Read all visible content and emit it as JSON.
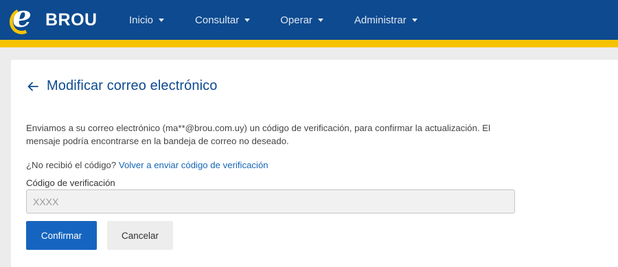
{
  "brand": {
    "name": "BROU",
    "logo_letter": "e"
  },
  "nav": {
    "items": [
      {
        "label": "Inicio"
      },
      {
        "label": "Consultar"
      },
      {
        "label": "Operar"
      },
      {
        "label": "Administrar"
      }
    ]
  },
  "page": {
    "title": "Modificar correo electrónico",
    "message": "Enviamos a su correo electrónico (ma**@brou.com.uy) un código de verificación, para confirmar la actualización. El mensaje podría encontrarse en la bandeja de correo no deseado.",
    "resend_prompt": "¿No recibió el código?",
    "resend_link": "Volver a enviar código de verificación",
    "code_label": "Código de verificación",
    "code_placeholder": "XXXX",
    "code_value": "",
    "confirm_label": "Confirmar",
    "cancel_label": "Cancelar"
  },
  "colors": {
    "navbar": "#0d4a8f",
    "accent": "#f6c200",
    "primary_button": "#1565c0",
    "link": "#1565b5"
  },
  "icons": {
    "back": "arrow-left-icon",
    "dropdown": "caret-down-icon"
  }
}
